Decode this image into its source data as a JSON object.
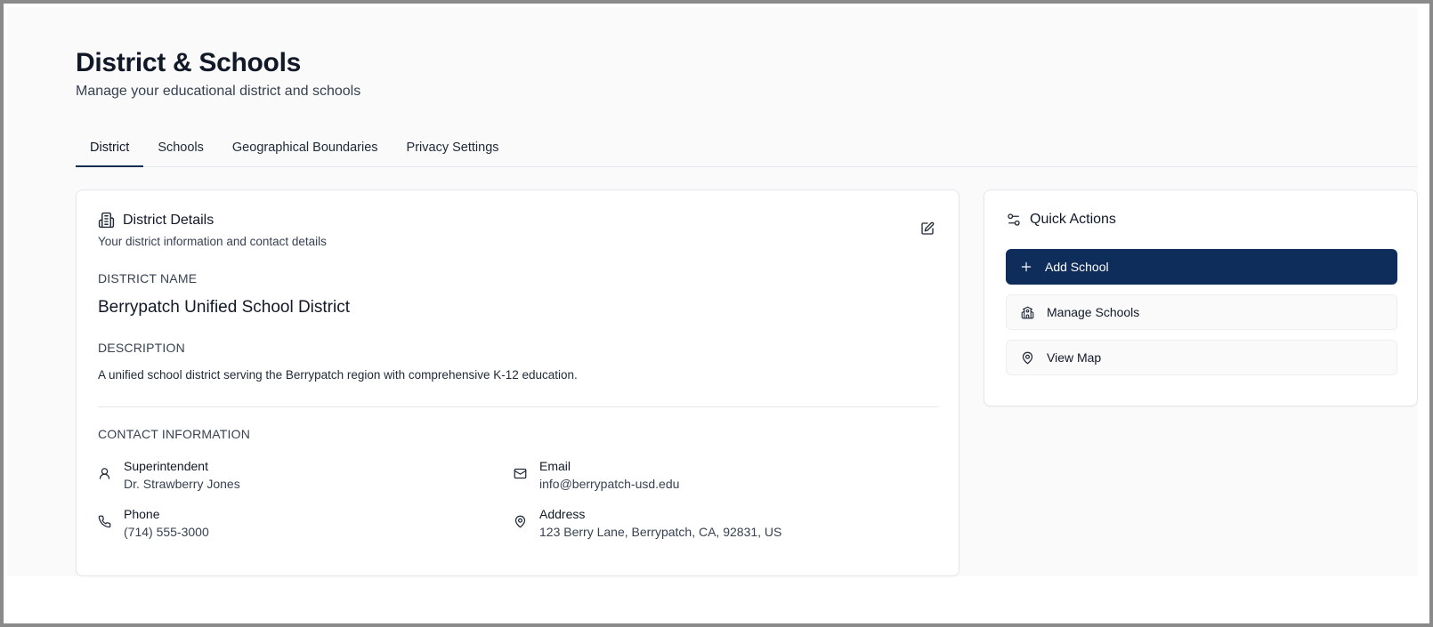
{
  "header": {
    "title": "District & Schools",
    "subtitle": "Manage your educational district and schools"
  },
  "tabs": [
    {
      "label": "District",
      "active": true
    },
    {
      "label": "Schools",
      "active": false
    },
    {
      "label": "Geographical Boundaries",
      "active": false
    },
    {
      "label": "Privacy Settings",
      "active": false
    }
  ],
  "district_card": {
    "title": "District Details",
    "description": "Your district information and contact details",
    "name_label": "DISTRICT NAME",
    "name_value": "Berrypatch Unified School District",
    "description_label": "DESCRIPTION",
    "description_value": "A unified school district serving the Berrypatch region with comprehensive K-12 education.",
    "contact_label": "CONTACT INFORMATION",
    "contacts": {
      "superintendent": {
        "label": "Superintendent",
        "value": "Dr. Strawberry Jones",
        "icon": "user-icon"
      },
      "email": {
        "label": "Email",
        "value": "info@berrypatch-usd.edu",
        "icon": "mail-icon"
      },
      "phone": {
        "label": "Phone",
        "value": "(714) 555-3000",
        "icon": "phone-icon"
      },
      "address": {
        "label": "Address",
        "value": "123 Berry Lane, Berrypatch, CA, 92831, US",
        "icon": "map-pin-icon"
      }
    }
  },
  "quick_actions": {
    "title": "Quick Actions",
    "buttons": [
      {
        "label": "Add School",
        "icon": "plus-icon",
        "style": "primary"
      },
      {
        "label": "Manage Schools",
        "icon": "school-icon",
        "style": "secondary"
      },
      {
        "label": "View Map",
        "icon": "map-pin-icon",
        "style": "secondary"
      }
    ]
  },
  "colors": {
    "primary": "#0f2d5a",
    "background": "#fafafa",
    "card": "#ffffff",
    "border": "#e5e7eb"
  }
}
